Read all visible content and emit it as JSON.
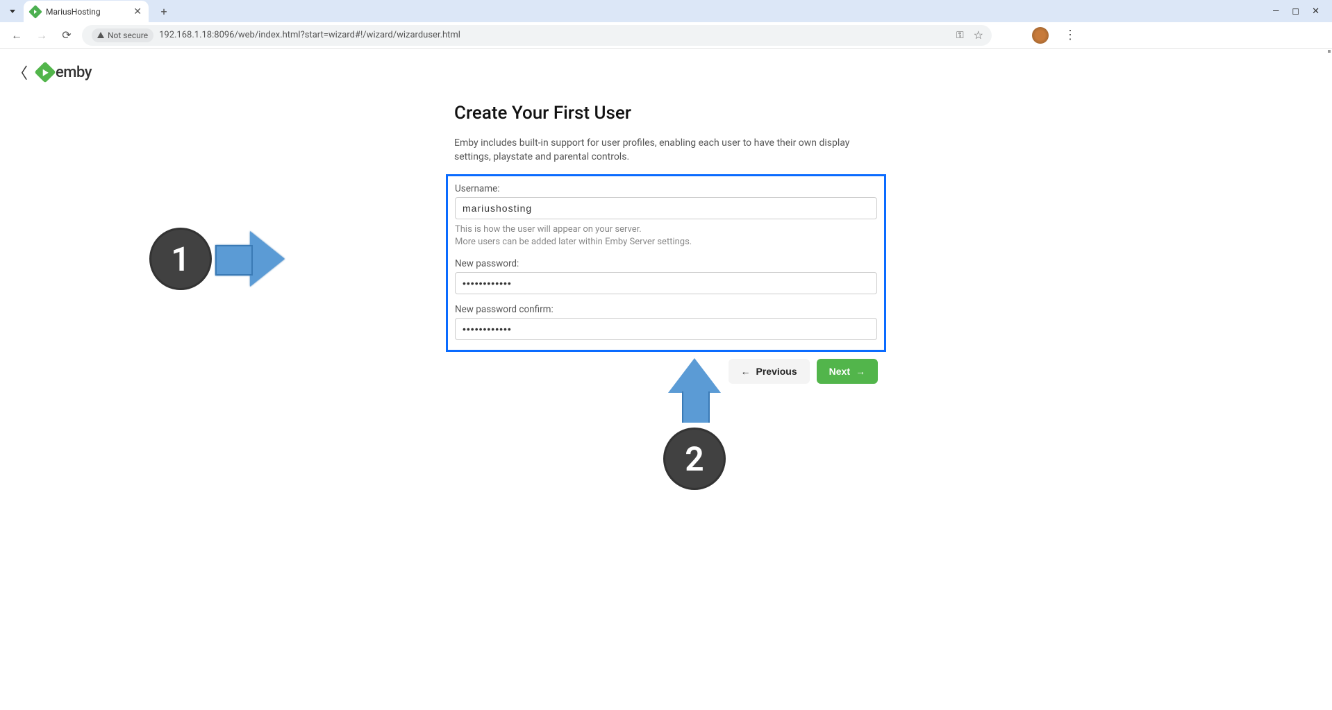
{
  "browser": {
    "tab_title": "MariusHosting",
    "url": "192.168.1.18:8096/web/index.html?start=wizard#!/wizard/wizarduser.html",
    "security_label": "Not secure"
  },
  "header": {
    "brand": "emby"
  },
  "wizard": {
    "title": "Create Your First User",
    "intro": "Emby includes built-in support for user profiles, enabling each user to have their own display settings, playstate and parental controls.",
    "username_label": "Username:",
    "username_value": "mariushosting",
    "username_hint1": "This is how the user will appear on your server.",
    "username_hint2": "More users can be added later within Emby Server settings.",
    "password_label": "New password:",
    "password_value": "••••••••••••",
    "password_confirm_label": "New password confirm:",
    "password_confirm_value": "••••••••••••",
    "prev_label": "Previous",
    "next_label": "Next"
  },
  "annotations": {
    "step1": "1",
    "step2": "2"
  }
}
